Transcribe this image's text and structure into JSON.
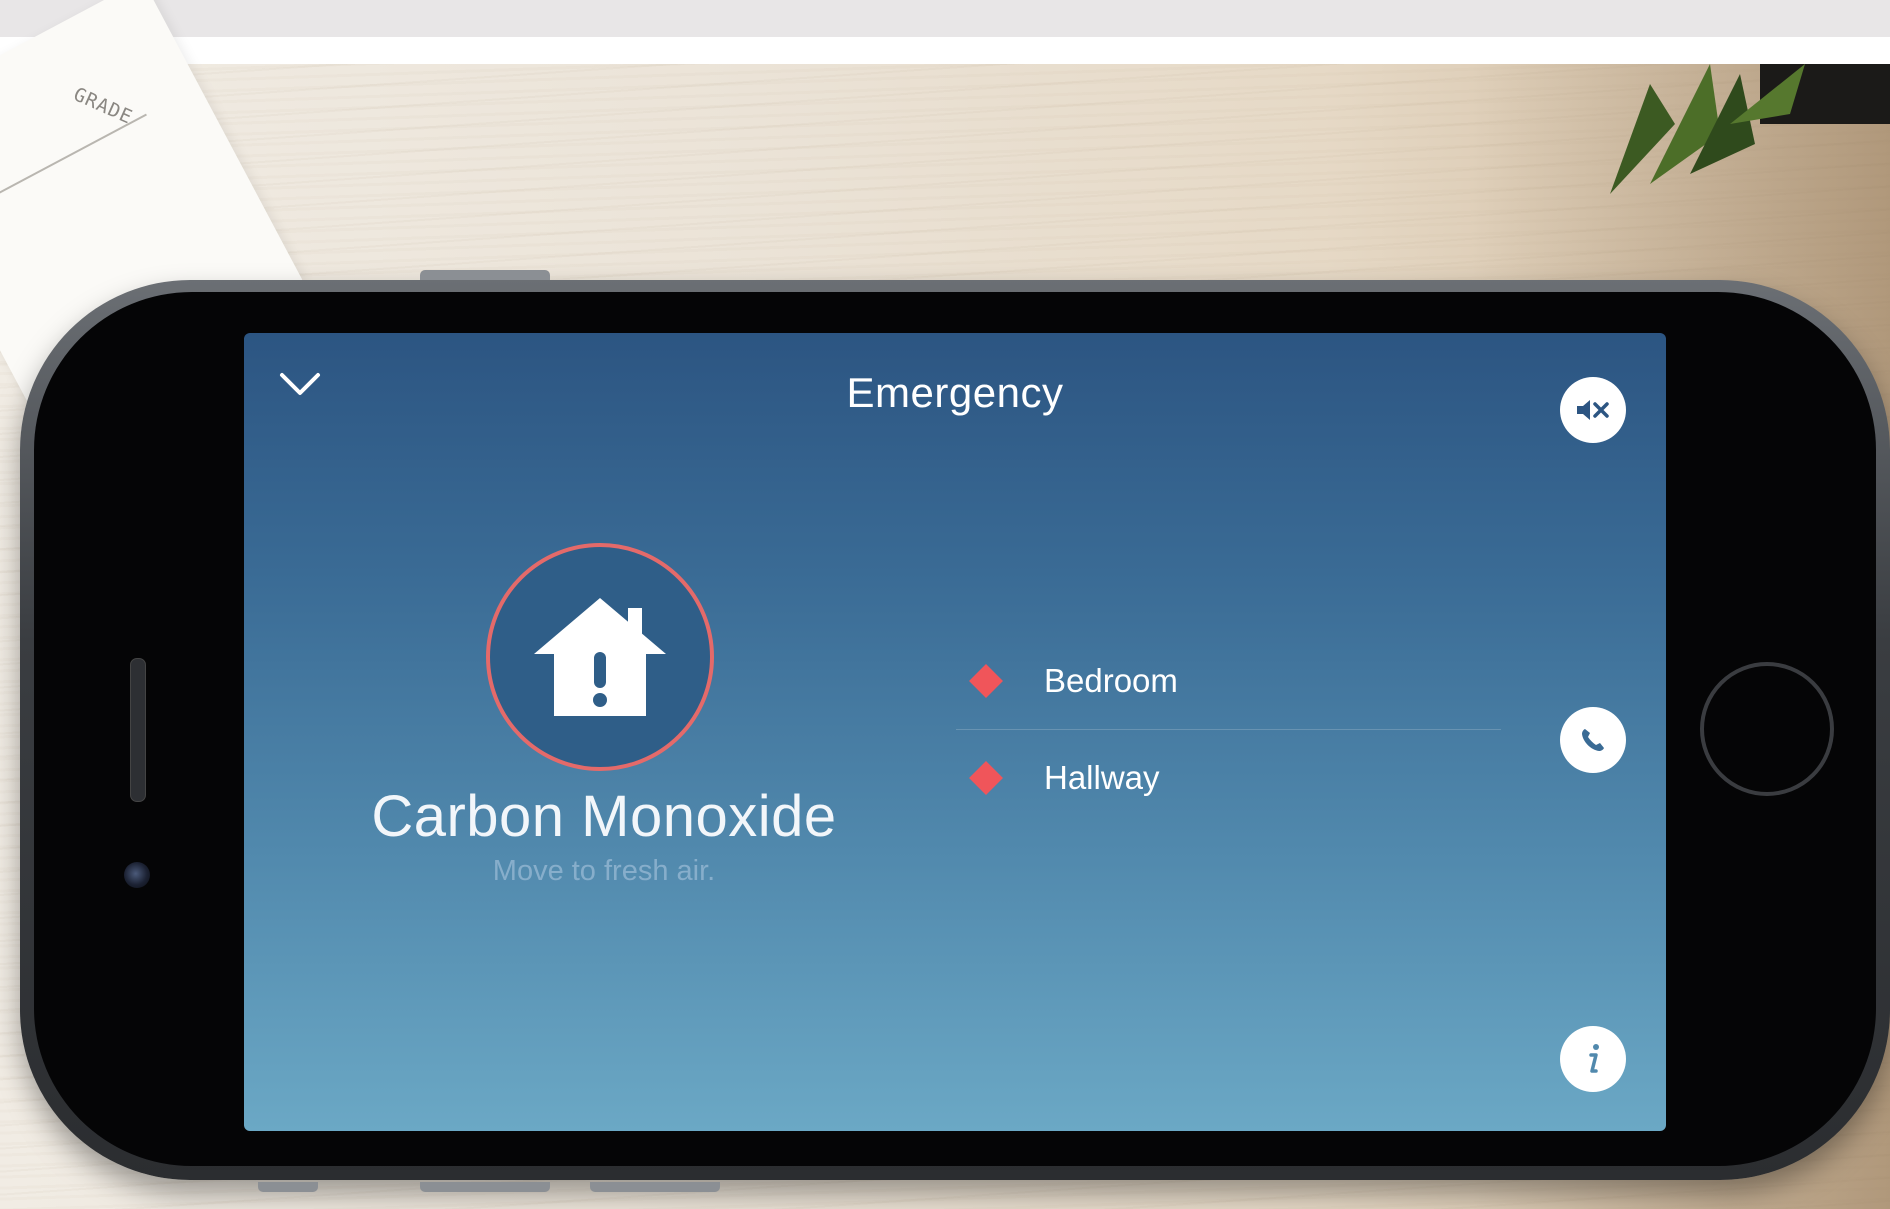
{
  "background": {
    "paper_text": "GRADE"
  },
  "app": {
    "title": "Emergency",
    "alarm": {
      "name": "Carbon Monoxide",
      "message": "Move to fresh air."
    },
    "locations": [
      {
        "label": "Bedroom",
        "status_color": "#f0555a"
      },
      {
        "label": "Hallway",
        "status_color": "#f0555a"
      }
    ],
    "icons": {
      "back": "chevron-down-icon",
      "mute": "speaker-mute-icon",
      "call": "phone-icon",
      "info": "info-icon",
      "alarm": "house-alert-icon"
    },
    "colors": {
      "alert_red": "#e46a6a",
      "screen_top": "#2c5582",
      "screen_bottom": "#6ba8c5"
    }
  }
}
